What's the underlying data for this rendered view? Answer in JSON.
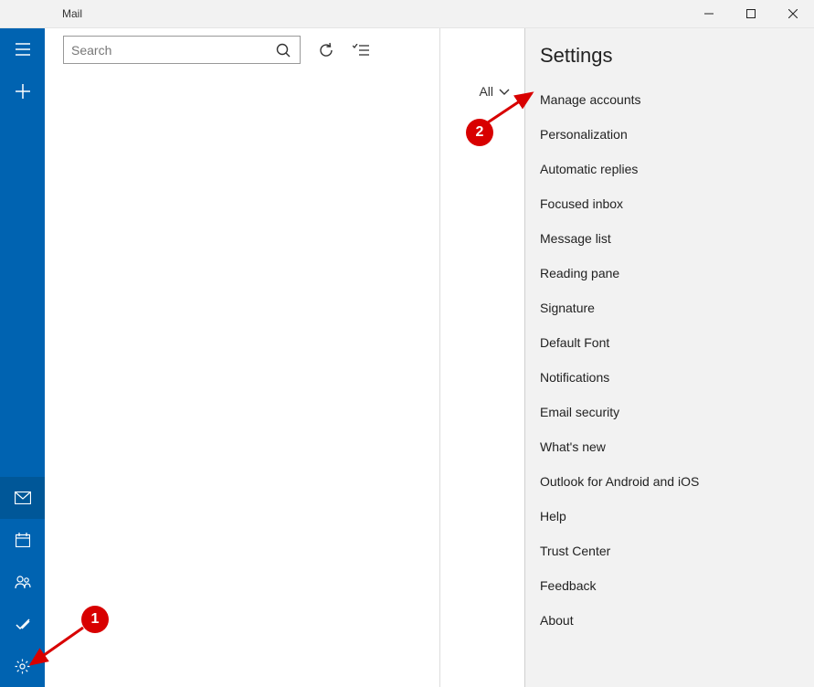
{
  "app": {
    "title": "Mail"
  },
  "window_controls": {
    "minimize": "—",
    "maximize": "☐",
    "close": "✕"
  },
  "search": {
    "placeholder": "Search"
  },
  "filter": {
    "label": "All"
  },
  "settings": {
    "title": "Settings",
    "items": [
      "Manage accounts",
      "Personalization",
      "Automatic replies",
      "Focused inbox",
      "Message list",
      "Reading pane",
      "Signature",
      "Default Font",
      "Notifications",
      "Email security",
      "What's new",
      "Outlook for Android and iOS",
      "Help",
      "Trust Center",
      "Feedback",
      "About"
    ]
  },
  "annotations": {
    "callout1": "1",
    "callout2": "2"
  }
}
